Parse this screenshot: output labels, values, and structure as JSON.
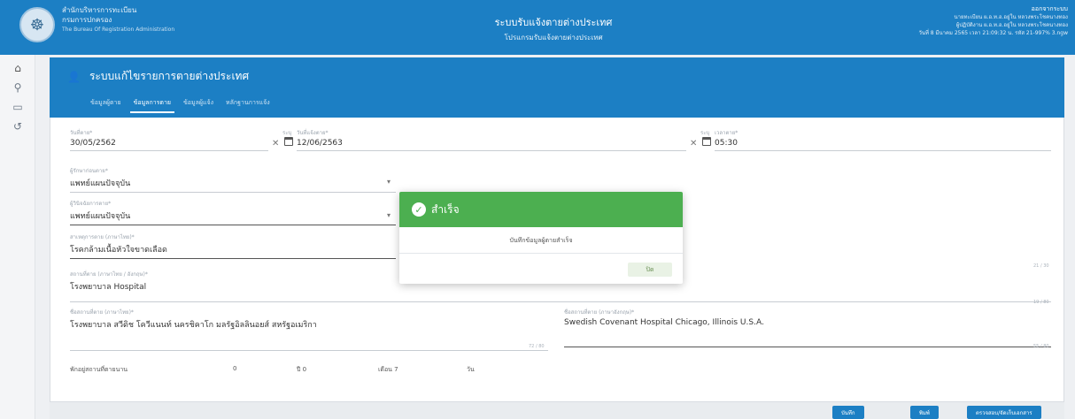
{
  "header": {
    "org_name_th": "สำนักบริหารการทะเบียน",
    "org_dept_th": "กรมการปกครอง",
    "org_name_en": "The Bureau Of Registration Administration",
    "system_title": "ระบบรับแจ้งตายต่างประเทศ",
    "system_subtitle": "โปรแกรมรับแจ้งตายต่างประเทศ",
    "logout": "ออกจากระบบ",
    "user_line1": "นายทะเบียน ผ.อ.ท.อ.อยู่ใน หลวงพระโชคนางทอง",
    "user_line2": "ผู้ปฏิบัติงาน ผ.อ.ท.อ.อยู่ใน หลวงพระโชคนางทอง",
    "user_line3": "วันที่ 8 มีนาคม 2565 เวลา 21:09:32 น.  รหัส 21-997% 3.ngw"
  },
  "rail": [
    "home-icon",
    "search-icon",
    "card-icon",
    "history-icon"
  ],
  "panel": {
    "title": "ระบบแก้ไขรายการตายต่างประเทศ",
    "tabs": [
      "ข้อมูลผู้ตาย",
      "ข้อมูลการตาย",
      "ข้อมูลผู้แจ้ง",
      "หลักฐานการแจ้ง"
    ],
    "active_tab": 1
  },
  "form": {
    "death_date_label": "วันที่ตาย*",
    "death_date": "30/05/2562",
    "notify_date_label": "วันที่แจ้งตาย*",
    "notify_date": "12/06/2563",
    "time_label": "เวลาตาย*",
    "time": "05:30",
    "cal_label": "ระบุ",
    "attend_label": "ผู้รักษาก่อนตาย*",
    "attend": "แพทย์แผนปัจจุบัน",
    "diagnose_label": "ผู้วินิจฉัยการตาย*",
    "diagnose": "แพทย์แผนปัจจุบัน",
    "cause_label": "สาเหตุการตาย (ภาษาไทย)*",
    "cause": "โรคกล้ามเนื้อหัวใจขาดเลือด",
    "place_label": "สถานที่ตาย (ภาษาไทย / อังกฤษ)*",
    "place": "โรงพยาบาล Hospital",
    "place_counter": "21 / 30",
    "place_counter2": "19 / 80",
    "place_th_label": "ชื่อสถานที่ตาย (ภาษาไทย)*",
    "place_th": "โรงพยาบาล สวีดิช โควีแนนท์  นครชิคาโก มลรัฐอิลลินอยส์   สหรัฐอเมริกา",
    "place_th_counter": "72 / 80",
    "place_en_label": "ชื่อสถานที่ตาย (ภาษาอังกฤษ)*",
    "place_en": "Swedish Covenant Hospital  Chicago, Illinois    U.S.A.",
    "place_en_counter": "55 / 80",
    "duration_label": "พักอยู่สถานที่ตายนาน",
    "dur_year": "0",
    "dur_year_unit": "ปี 0",
    "dur_month_unit": "เดือน 7",
    "dur_day_unit": "วัน"
  },
  "actions": {
    "save": "บันทึก",
    "print": "พิมพ์",
    "check": "ตรวจสอบ/จัดเก็บเอกสาร"
  },
  "modal": {
    "title": "สำเร็จ",
    "message": "บันทึกข้อมูลผู้ตายสำเร็จ",
    "ok": "ปิด"
  }
}
